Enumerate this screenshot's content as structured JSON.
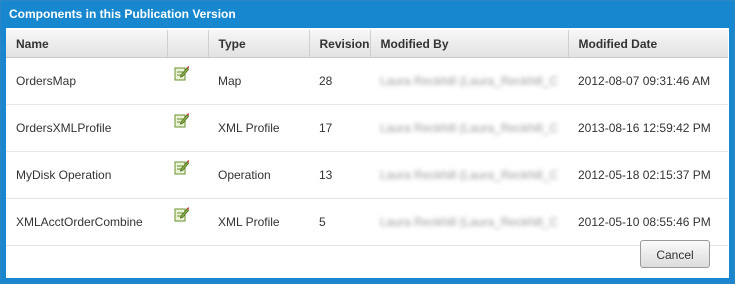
{
  "dialog": {
    "title": "Components in this Publication Version"
  },
  "table": {
    "columns": {
      "name": "Name",
      "icon": "",
      "type": "Type",
      "revision": "Revision",
      "modified_by": "Modified By",
      "modified_date": "Modified Date"
    },
    "rows": [
      {
        "name": "OrdersMap",
        "icon": "edit-icon",
        "type": "Map",
        "revision": "28",
        "modified_by": "Laura Reckhill (Laura_Reckhill_C",
        "modified_date": "2012-08-07 09:31:46 AM"
      },
      {
        "name": "OrdersXMLProfile",
        "icon": "edit-icon",
        "type": "XML Profile",
        "revision": "17",
        "modified_by": "Laura Reckhill (Laura_Reckhill_C",
        "modified_date": "2013-08-16 12:59:42 PM"
      },
      {
        "name": "MyDisk Operation",
        "icon": "edit-icon",
        "type": "Operation",
        "revision": "13",
        "modified_by": "Laura Reckhill (Laura_Reckhill_C",
        "modified_date": "2012-05-18 02:15:37 PM"
      },
      {
        "name": "XMLAcctOrderCombine",
        "icon": "edit-icon",
        "type": "XML Profile",
        "revision": "5",
        "modified_by": "Laura Reckhill (Laura_Reckhill_C",
        "modified_date": "2012-05-10 08:55:46 PM"
      }
    ]
  },
  "buttons": {
    "cancel": "Cancel"
  }
}
